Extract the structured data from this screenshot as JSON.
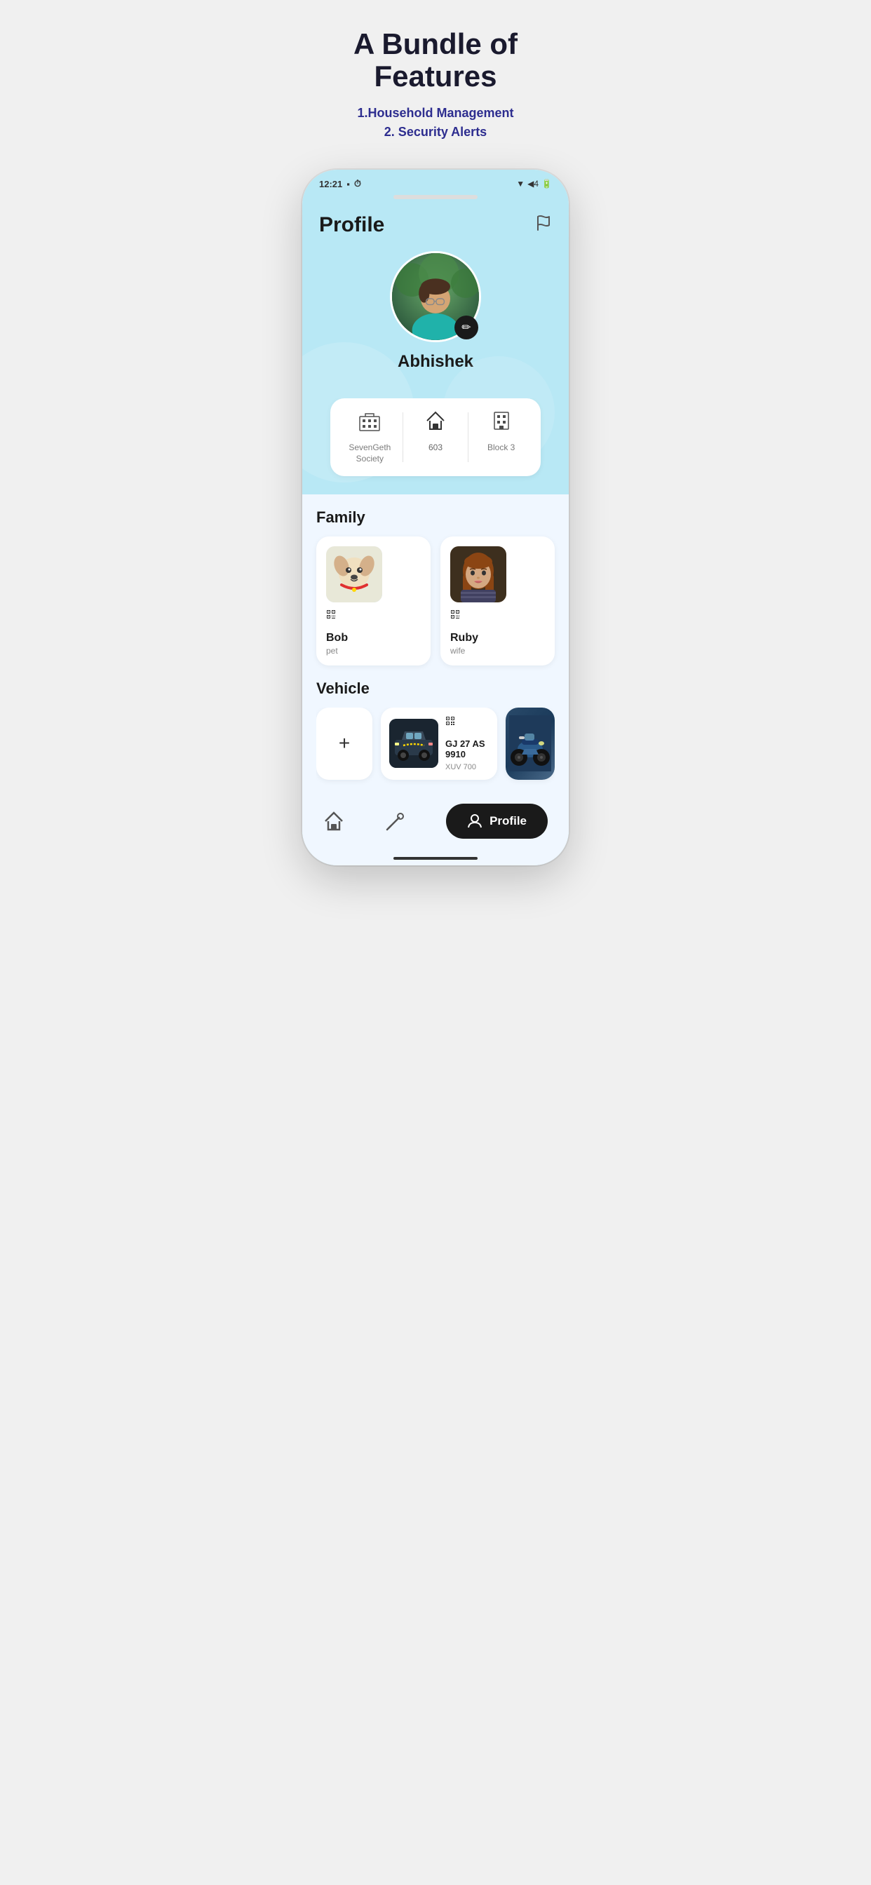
{
  "header": {
    "title": "A Bundle of Features",
    "subtitle_line1": "1.Household Management",
    "subtitle_line2": "2. Security Alerts"
  },
  "status_bar": {
    "time": "12:21",
    "wifi": "▲4",
    "battery": "🔋"
  },
  "app": {
    "title": "Profile",
    "user_name": "Abhishek",
    "flag_label": "flag",
    "edit_label": "edit",
    "info": [
      {
        "icon": "🏢",
        "label": "SevenGeth\nSociety"
      },
      {
        "icon": "🏠",
        "label": "603"
      },
      {
        "icon": "🏗",
        "label": "Block 3"
      }
    ],
    "family_section": {
      "title": "Family",
      "members": [
        {
          "name": "Bob",
          "role": "pet",
          "emoji": "🐶"
        },
        {
          "name": "Ruby",
          "role": "wife",
          "emoji": "👩"
        }
      ]
    },
    "vehicle_section": {
      "title": "Vehicle",
      "add_label": "+",
      "vehicles": [
        {
          "plate": "GJ 27 AS\n9910",
          "model": "XUV 700",
          "emoji": "🚙"
        },
        {
          "model": "scooter",
          "emoji": "🛵"
        }
      ]
    },
    "bottom_nav": {
      "home_label": "home",
      "tools_label": "tools",
      "profile_label": "Profile"
    }
  }
}
